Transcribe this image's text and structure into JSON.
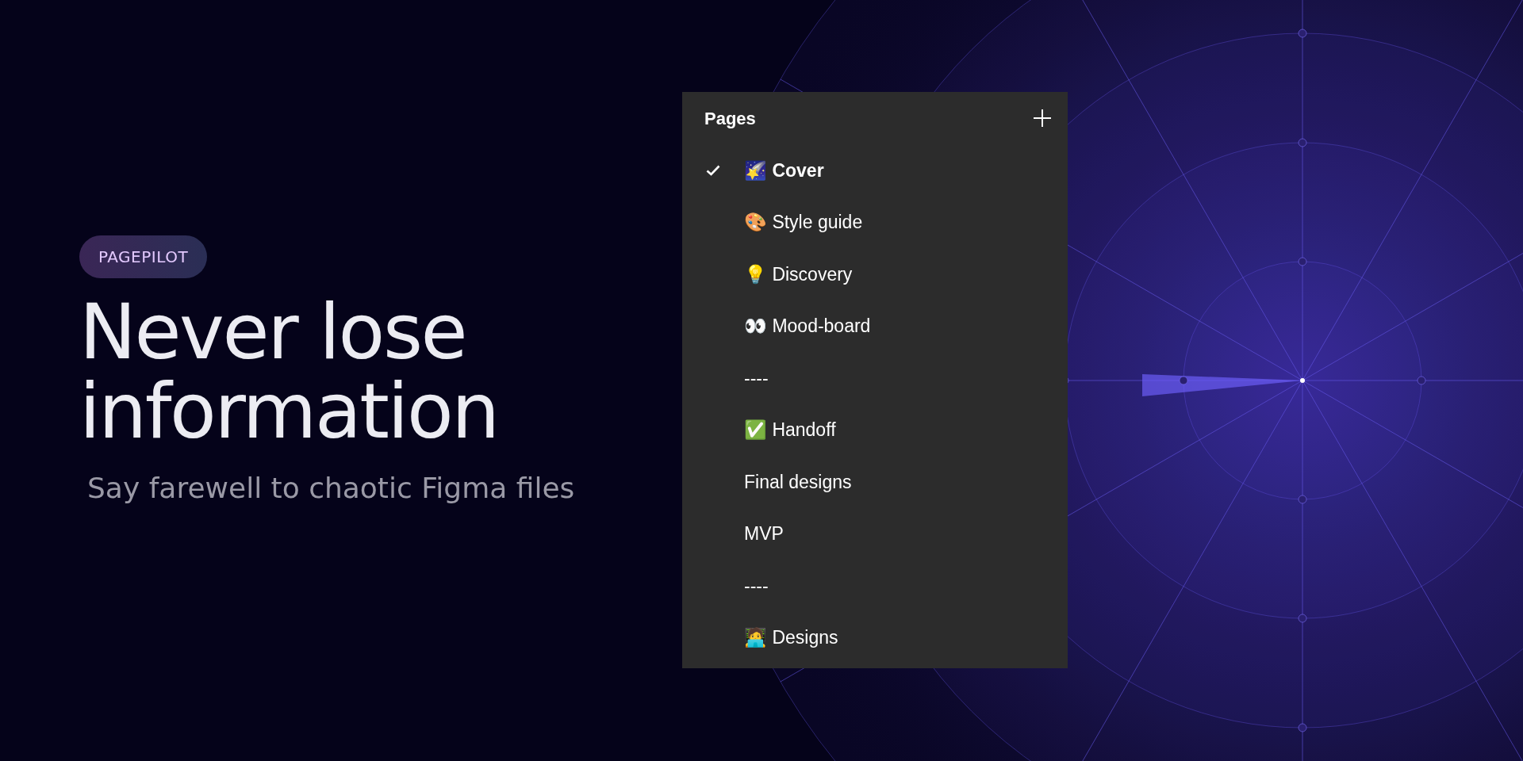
{
  "badge": "PAGEPILOT",
  "headline": [
    "Never lose",
    "information"
  ],
  "subtitle": "Say farewell to chaotic Figma files",
  "panel": {
    "title": "Pages",
    "items": [
      {
        "label": "🌠 Cover",
        "selected": true
      },
      {
        "label": "🎨 Style guide",
        "selected": false
      },
      {
        "label": "💡 Discovery",
        "selected": false
      },
      {
        "label": "👀 Mood-board",
        "selected": false
      },
      {
        "label": "----",
        "selected": false
      },
      {
        "label": "✅ Handoff",
        "selected": false
      },
      {
        "label": "Final designs",
        "selected": false
      },
      {
        "label": "MVP",
        "selected": false
      },
      {
        "label": "----",
        "selected": false
      },
      {
        "label": "🧑‍💻 Designs",
        "selected": false
      }
    ]
  }
}
